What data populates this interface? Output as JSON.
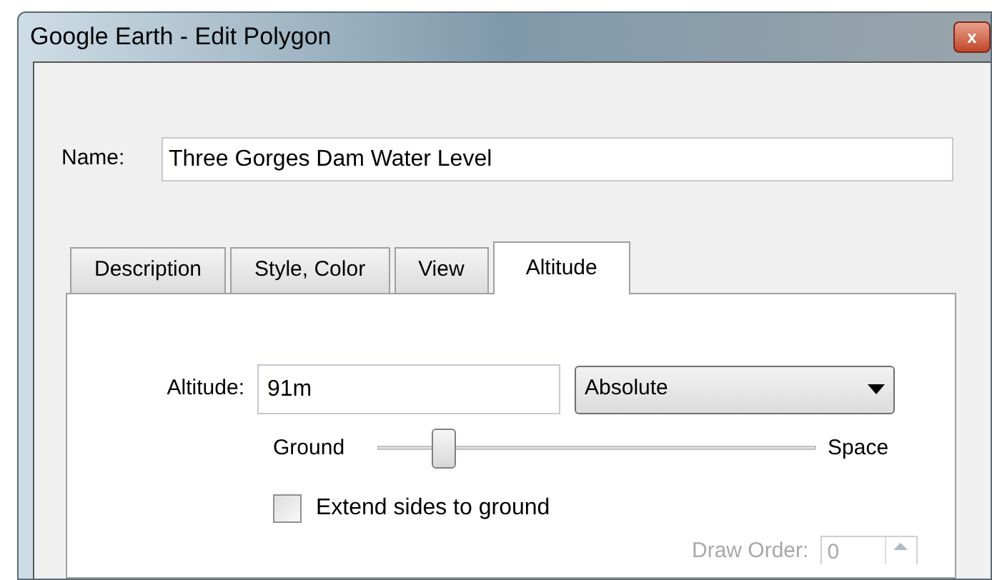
{
  "window": {
    "title": "Google Earth - Edit Polygon",
    "close": "x"
  },
  "name_field": {
    "label": "Name:",
    "value": "Three Gorges Dam Water Level"
  },
  "tabs": [
    {
      "label": "Description",
      "selected": false
    },
    {
      "label": "Style, Color",
      "selected": false
    },
    {
      "label": "View",
      "selected": false
    },
    {
      "label": "Altitude",
      "selected": true
    }
  ],
  "altitude": {
    "label": "Altitude:",
    "value": "91m",
    "mode": "Absolute"
  },
  "slider": {
    "min_label": "Ground",
    "max_label": "Space",
    "level": 0.13
  },
  "extend_sides": {
    "label": "Extend sides to ground",
    "checked": false
  },
  "draw_order": {
    "label": "Draw Order:",
    "value": "0",
    "disabled": true
  }
}
